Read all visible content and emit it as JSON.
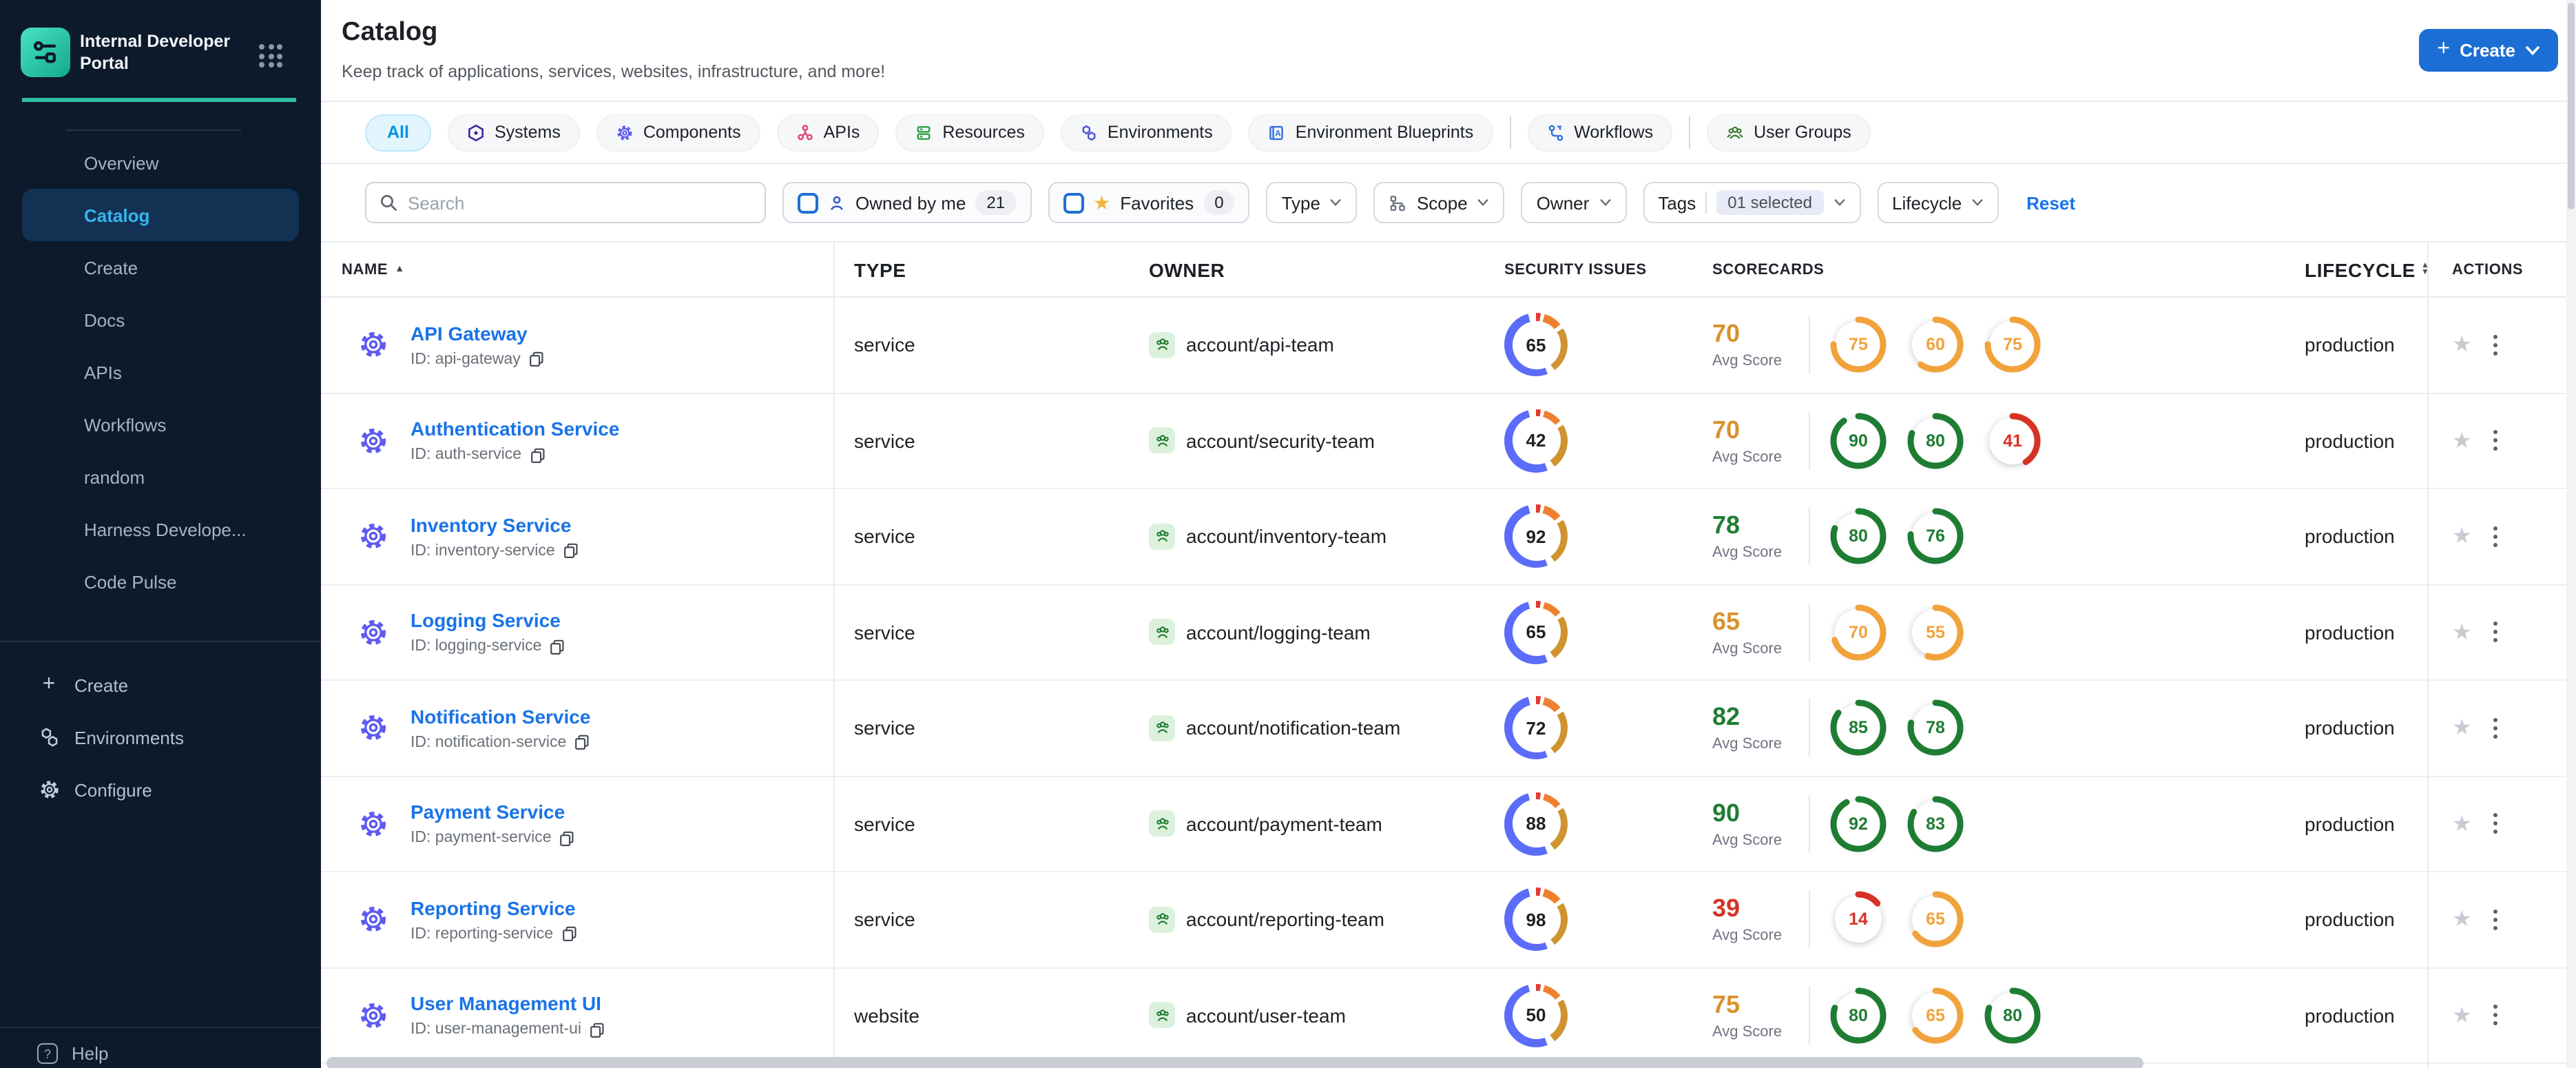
{
  "sidebar": {
    "title": "Internal Developer Portal",
    "nav": [
      {
        "label": "Overview"
      },
      {
        "label": "Catalog",
        "active": true
      },
      {
        "label": "Create"
      },
      {
        "label": "Docs"
      },
      {
        "label": "APIs"
      },
      {
        "label": "Workflows"
      },
      {
        "label": "random"
      },
      {
        "label": "Harness Develope..."
      },
      {
        "label": "Code Pulse"
      }
    ],
    "bottom_nav": [
      {
        "label": "Create"
      },
      {
        "label": "Environments"
      },
      {
        "label": "Configure"
      }
    ],
    "help_label": "Help"
  },
  "header": {
    "title": "Catalog",
    "subtitle": "Keep track of applications, services, websites, infrastructure, and more!",
    "create_label": "Create"
  },
  "tabs": [
    {
      "label": "All",
      "active": true
    },
    {
      "label": "Systems"
    },
    {
      "label": "Components"
    },
    {
      "label": "APIs"
    },
    {
      "label": "Resources"
    },
    {
      "label": "Environments"
    },
    {
      "label": "Environment Blueprints"
    },
    {
      "label": "Workflows"
    },
    {
      "label": "User Groups"
    }
  ],
  "filters": {
    "search_placeholder": "Search",
    "owned_by_me": {
      "label": "Owned by me",
      "count": "21"
    },
    "favorites": {
      "label": "Favorites",
      "count": "0"
    },
    "type_label": "Type",
    "scope_label": "Scope",
    "owner_label": "Owner",
    "tags_label": "Tags",
    "tags_selected": "01 selected",
    "lifecycle_label": "Lifecycle",
    "reset_label": "Reset"
  },
  "table": {
    "columns": {
      "name": "NAME",
      "type": "TYPE",
      "owner": "OWNER",
      "security": "SECURITY ISSUES",
      "scorecards": "SCORECARDS",
      "lifecycle": "LIFECYCLE",
      "actions": "ACTIONS"
    },
    "avg_score_label": "Avg Score",
    "rows": [
      {
        "name": "API Gateway",
        "id_label": "ID: api-gateway",
        "type": "service",
        "owner": "account/api-team",
        "security": 65,
        "avg": 70,
        "scorecards": [
          75,
          60,
          75
        ],
        "lifecycle": "production"
      },
      {
        "name": "Authentication Service",
        "id_label": "ID: auth-service",
        "type": "service",
        "owner": "account/security-team",
        "security": 42,
        "avg": 70,
        "scorecards": [
          90,
          80,
          41
        ],
        "lifecycle": "production"
      },
      {
        "name": "Inventory Service",
        "id_label": "ID: inventory-service",
        "type": "service",
        "owner": "account/inventory-team",
        "security": 92,
        "avg": 78,
        "scorecards": [
          80,
          76
        ],
        "lifecycle": "production"
      },
      {
        "name": "Logging Service",
        "id_label": "ID: logging-service",
        "type": "service",
        "owner": "account/logging-team",
        "security": 65,
        "avg": 65,
        "scorecards": [
          70,
          55
        ],
        "lifecycle": "production"
      },
      {
        "name": "Notification Service",
        "id_label": "ID: notification-service",
        "type": "service",
        "owner": "account/notification-team",
        "security": 72,
        "avg": 82,
        "scorecards": [
          85,
          78
        ],
        "lifecycle": "production"
      },
      {
        "name": "Payment Service",
        "id_label": "ID: payment-service",
        "type": "service",
        "owner": "account/payment-team",
        "security": 88,
        "avg": 90,
        "scorecards": [
          92,
          83
        ],
        "lifecycle": "production"
      },
      {
        "name": "Reporting Service",
        "id_label": "ID: reporting-service",
        "type": "service",
        "owner": "account/reporting-team",
        "security": 98,
        "avg": 39,
        "scorecards": [
          14,
          65
        ],
        "lifecycle": "production"
      },
      {
        "name": "User Management UI",
        "id_label": "ID: user-management-ui",
        "type": "website",
        "owner": "account/user-team",
        "security": 50,
        "avg": 75,
        "scorecards": [
          80,
          65,
          80
        ],
        "lifecycle": "production"
      }
    ]
  },
  "colors": {
    "accent_teal": "#2fbf9f",
    "primary_blue": "#1a73e8",
    "create_button_blue": "#1b6fd4",
    "score_green": "#1e7d32",
    "score_orange": "#f2a23b",
    "score_red": "#d63226",
    "avg_orange": "#d9922e",
    "donut_blue": "#5b6cf9",
    "donut_gold": "#cf9430",
    "donut_orange": "#f07f2e",
    "donut_red": "#df3d33"
  }
}
